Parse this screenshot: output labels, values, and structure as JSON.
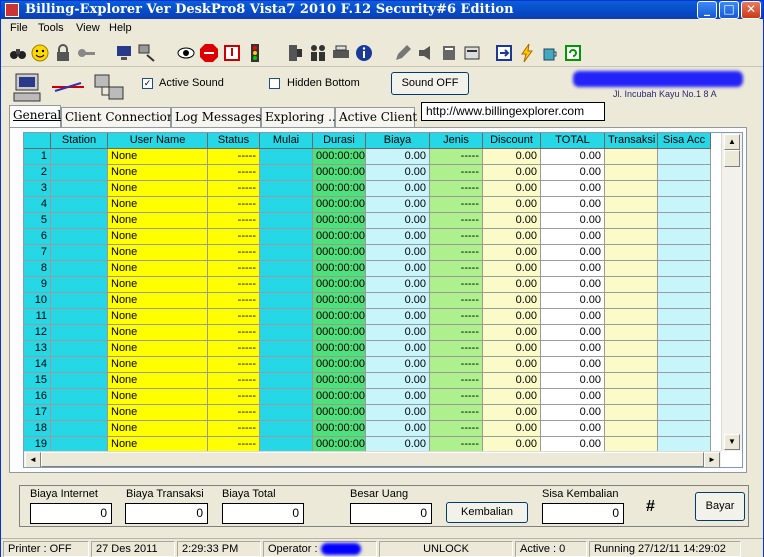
{
  "window": {
    "title": "Billing-Explorer Ver DeskPro8 Vista7 2010 F.12 Security#6 Edition",
    "min_glyph": "_",
    "max_glyph": "□",
    "close_glyph": "✕"
  },
  "menu": [
    "File",
    "Tools",
    "View",
    "Help"
  ],
  "toolbar_icons": [
    "binoculars-icon",
    "smiley-icon",
    "lock-icon",
    "key-icon",
    "monitor-settings-icon",
    "network-icon",
    "eye-icon",
    "stop-icon",
    "window-icon",
    "traffic-light-icon",
    "computer-tower-icon",
    "users-icon",
    "printer-icon",
    "info-icon",
    "edit-icon",
    "audio-icon",
    "database-icon",
    "report-icon",
    "export-icon",
    "lightning-icon",
    "coffee-icon",
    "refresh-icon"
  ],
  "controls": {
    "active_sound": {
      "label": "Active Sound",
      "checked": true
    },
    "hidden_bottom": {
      "label": "Hidden Bottom",
      "checked": false
    },
    "sound_off": "Sound OFF",
    "check_glyph": "✓",
    "brand_address": "Jl. Incubah Kayu No.1 8 A"
  },
  "tabs": [
    "General",
    "Client Connection",
    "Log Messages",
    "Exploring ...",
    "Active Client"
  ],
  "url": "http://www.billingexplorer.com",
  "grid": {
    "columns": [
      "",
      "Station",
      "User Name",
      "Status",
      "Mulai",
      "Durasi",
      "Biaya",
      "Jenis",
      "Discount",
      "TOTAL",
      "Transaksi",
      "Sisa Acc"
    ],
    "default_row": {
      "station": "",
      "user": "None",
      "status": "-----",
      "mulai": "",
      "durasi": "000:00:00",
      "biaya": "0.00",
      "jenis": "-----",
      "discount": "0.00",
      "total": "0.00",
      "transaksi": "",
      "sisa": ""
    },
    "row_count": 19
  },
  "scroll_glyphs": {
    "up": "▲",
    "down": "▼",
    "left": "◄",
    "right": "►"
  },
  "billing": {
    "biaya_internet": {
      "label": "Biaya Internet",
      "value": "0"
    },
    "biaya_transaksi": {
      "label": "Biaya Transaksi",
      "value": "0"
    },
    "biaya_total": {
      "label": "Biaya Total",
      "value": "0"
    },
    "besar_uang": {
      "label": "Besar Uang",
      "value": "0"
    },
    "kembalian_button": "Kembalian",
    "sisa_kembalian": {
      "label": "Sisa Kembalian",
      "value": "0"
    },
    "hash": "#",
    "bayar_button": "Bayar"
  },
  "statusbar": {
    "printer": "Printer : OFF",
    "date": "27 Des 2011",
    "time": "2:29:33 PM",
    "operator": "Operator :",
    "lock": "UNLOCK",
    "active": "Active :  0",
    "running": "Running 27/12/11  14:29:02"
  },
  "colors": {
    "header": "#26d7e6",
    "station": "#26d7e6",
    "user": "#ffff00",
    "status": "#ffff00",
    "mulai": "#26d7e6",
    "durasi": "#4ee07a",
    "biaya": "#c8f5fb",
    "jenis": "#aef08e",
    "discount": "#fbfbc8",
    "total": "#ffffff",
    "transaksi": "#fbfbc8",
    "sisa": "#c8f5fb",
    "rownum": "#26d7e6"
  }
}
